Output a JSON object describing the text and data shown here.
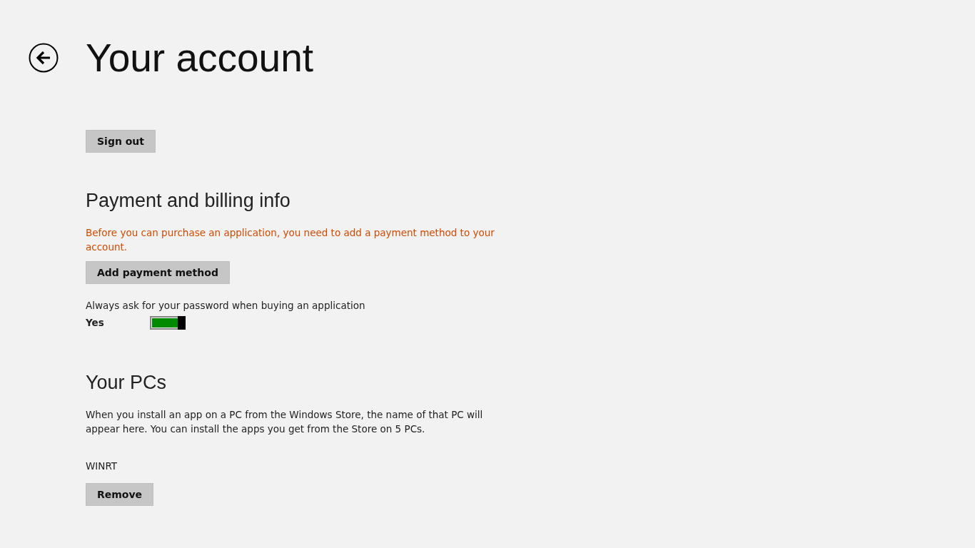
{
  "page": {
    "title": "Your account"
  },
  "sign_out_button": "Sign out",
  "payment": {
    "heading": "Payment and billing info",
    "warning": "Before you can purchase an application, you need to add a payment method to your account.",
    "add_button": "Add payment method",
    "password_toggle": {
      "label": "Always ask for your password when buying an application",
      "value": "Yes",
      "on": true
    }
  },
  "pcs": {
    "heading": "Your PCs",
    "description": "When you install an app on a PC from the Windows Store, the name of that PC will appear here. You can install the apps you get from the Store on 5 PCs.",
    "devices": [
      {
        "name": "WINRT",
        "button": "Remove"
      }
    ]
  }
}
